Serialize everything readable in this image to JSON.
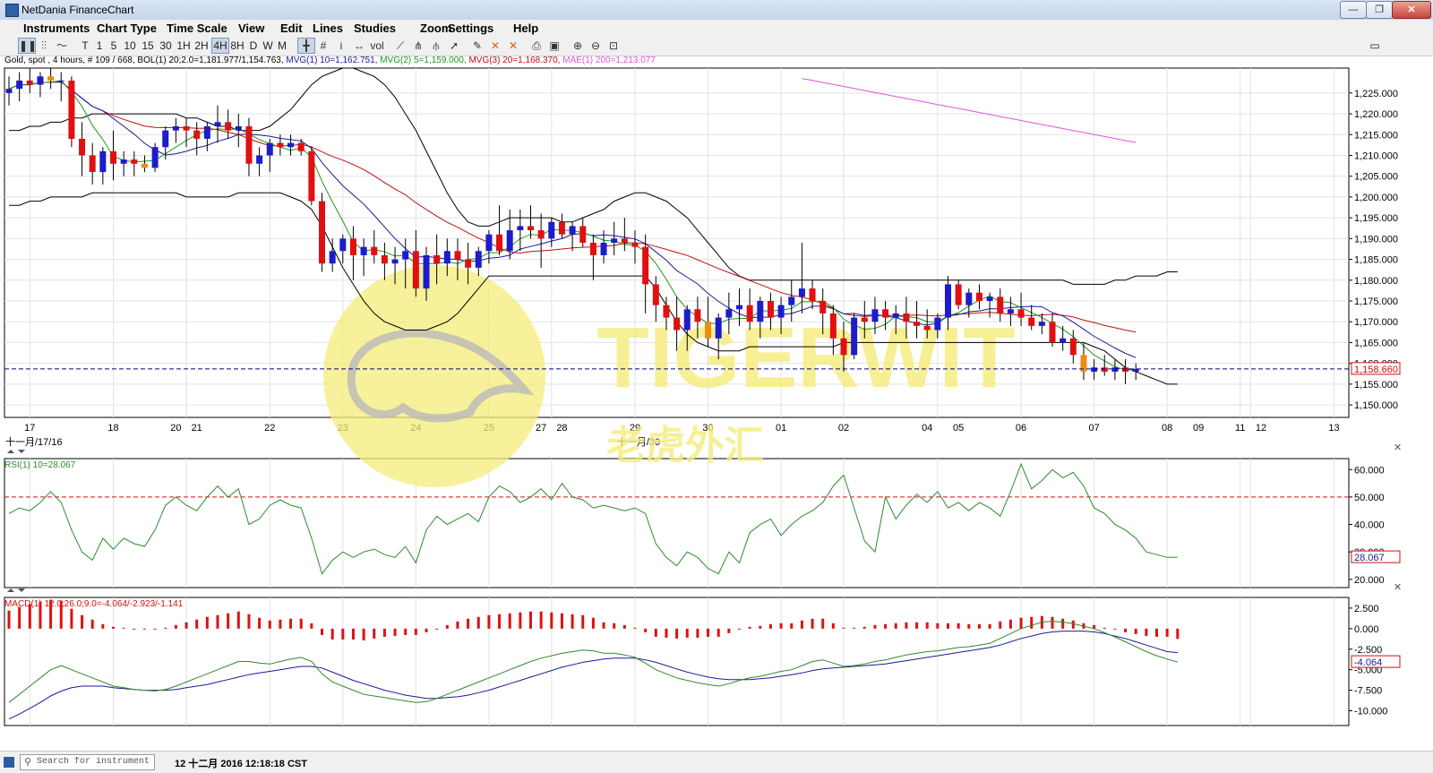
{
  "window": {
    "title": "NetDania FinanceChart",
    "minimize": "—",
    "maximize": "❐",
    "close": "✕"
  },
  "menu": [
    "Instruments",
    "Chart Type",
    "Time Scale",
    "View",
    "Edit",
    "Lines",
    "Studies",
    "Zoom",
    "Settings",
    "Help"
  ],
  "toolbar": {
    "chart_type_icons": [
      "candlestick-chart-icon",
      "bar-chart-icon",
      "line-chart-icon"
    ],
    "timescales": [
      "T",
      "1",
      "5",
      "10",
      "15",
      "30",
      "1H",
      "2H",
      "4H",
      "8H",
      "D",
      "W",
      "M"
    ],
    "selected_timescale": "4H",
    "tool_icons": [
      "crosshair-icon",
      "grid-icon",
      "info-icon",
      "arrows-icon",
      "volume-icon",
      "trend-line-icon",
      "fork-icon",
      "fan-icon",
      "arrow-tool-icon",
      "pen-icon",
      "delete-lines-icon",
      "delete-all-icon",
      "print-icon",
      "preview-icon",
      "zoom-in-icon",
      "zoom-out-icon",
      "zoom-fit-icon"
    ],
    "volume_label": "vol",
    "info_label": "i"
  },
  "legend": {
    "instrument": "Gold, spot , 4 hours, # 109 / 668, BOL(1) 20;2.0=1,181.977/1,154.763,",
    "mvg1": "MVG(1) 10=1,162.751,",
    "mvg2": "MVG(2) 5=1,159.000,",
    "mvg3": "MVG(3) 20=1,168.370,",
    "mae": "MAE(1) 200=1,213.077"
  },
  "colors": {
    "up_candle": "#1c1ccc",
    "down_candle": "#e01010",
    "orange_candle": "#f08a10",
    "mvg1": "#1a1a9a",
    "mvg2": "#1e9a1e",
    "mvg3": "#c01010",
    "mae": "#dd55dd",
    "bollinger": "#000000",
    "price_line": "#000080",
    "rsi": "#2d8a2d",
    "macd_signal": "#1a1a9a",
    "macd_line": "#2d8a2d",
    "macd_hist": "#e01010",
    "watermark": "#f6ec7a"
  },
  "watermark": {
    "brand": "TIGERWIT",
    "chinese": "老虎外汇"
  },
  "price_axis": {
    "ticks": [
      "1,225.000",
      "1,220.000",
      "1,215.000",
      "1,210.000",
      "1,205.000",
      "1,200.000",
      "1,195.000",
      "1,190.000",
      "1,185.000",
      "1,180.000",
      "1,175.000",
      "1,170.000",
      "1,165.000",
      "1,160.000",
      "1,155.000",
      "1,150.000"
    ],
    "last_price": "1,158.660"
  },
  "time_axis": {
    "labels": [
      "17",
      "18",
      "20",
      "21",
      "22",
      "23",
      "24",
      "25",
      "27",
      "28",
      "29",
      "30",
      "01",
      "02",
      "04",
      "05",
      "06",
      "07",
      "08",
      "09",
      "11",
      "12",
      "13"
    ],
    "month_labels": [
      "十一月/17/16",
      "十一月/30"
    ]
  },
  "rsi": {
    "label": "RSI(1) 10=28.067",
    "ticks": [
      "60.000",
      "50.000",
      "40.000",
      "30.000",
      "20.000"
    ],
    "last": "28.067",
    "level": 50
  },
  "macd": {
    "label": "MACD(1) 12.0;26.0;9.0=-4.064/-2.923/-1.141",
    "ticks": [
      "2.500",
      "0.000",
      "-2.500",
      "-5.000",
      "-7.500",
      "-10.000"
    ],
    "last": "-4.064"
  },
  "status": {
    "search_placeholder": "Search for instrument",
    "time": "12 十二月 2016 12:18:18 CST"
  },
  "chart_data": {
    "type": "candlestick",
    "instrument": "Gold, spot",
    "timeframe": "4 hours",
    "price_range": [
      1147,
      1231
    ],
    "ohlc": [
      [
        1225,
        1229,
        1222,
        1226
      ],
      [
        1226,
        1230,
        1223,
        1228
      ],
      [
        1228,
        1231,
        1225,
        1227
      ],
      [
        1227,
        1230,
        1224,
        1229
      ],
      [
        1229,
        1231,
        1226,
        1228
      ],
      [
        1228,
        1230,
        1223,
        1228
      ],
      [
        1228,
        1229,
        1212,
        1214
      ],
      [
        1214,
        1218,
        1205,
        1210
      ],
      [
        1210,
        1213,
        1203,
        1206
      ],
      [
        1206,
        1212,
        1203,
        1211
      ],
      [
        1211,
        1216,
        1204,
        1208
      ],
      [
        1208,
        1211,
        1205,
        1209
      ],
      [
        1209,
        1211,
        1205,
        1208
      ],
      [
        1208,
        1210,
        1206,
        1207
      ],
      [
        1207,
        1213,
        1206,
        1212
      ],
      [
        1212,
        1217,
        1209,
        1216
      ],
      [
        1216,
        1219,
        1213,
        1217
      ],
      [
        1217,
        1219,
        1212,
        1216
      ],
      [
        1216,
        1218,
        1210,
        1214
      ],
      [
        1214,
        1218,
        1211,
        1217
      ],
      [
        1217,
        1222,
        1213,
        1218
      ],
      [
        1218,
        1221,
        1214,
        1216
      ],
      [
        1216,
        1220,
        1212,
        1217
      ],
      [
        1217,
        1219,
        1205,
        1208
      ],
      [
        1208,
        1212,
        1205,
        1210
      ],
      [
        1210,
        1214,
        1206,
        1213
      ],
      [
        1213,
        1215,
        1210,
        1212
      ],
      [
        1212,
        1215,
        1210,
        1213
      ],
      [
        1213,
        1214,
        1210,
        1211
      ],
      [
        1211,
        1212,
        1198,
        1199
      ],
      [
        1199,
        1201,
        1182,
        1184
      ],
      [
        1184,
        1190,
        1182,
        1187
      ],
      [
        1187,
        1191,
        1184,
        1190
      ],
      [
        1190,
        1193,
        1180,
        1186
      ],
      [
        1186,
        1190,
        1181,
        1188
      ],
      [
        1188,
        1192,
        1184,
        1186
      ],
      [
        1186,
        1189,
        1180,
        1184
      ],
      [
        1184,
        1188,
        1179,
        1185
      ],
      [
        1185,
        1190,
        1178,
        1187
      ],
      [
        1187,
        1192,
        1176,
        1178
      ],
      [
        1178,
        1188,
        1175,
        1186
      ],
      [
        1186,
        1191,
        1179,
        1184
      ],
      [
        1184,
        1190,
        1181,
        1187
      ],
      [
        1187,
        1190,
        1180,
        1185
      ],
      [
        1185,
        1189,
        1179,
        1183
      ],
      [
        1183,
        1188,
        1181,
        1187
      ],
      [
        1187,
        1192,
        1184,
        1191
      ],
      [
        1191,
        1198,
        1186,
        1187
      ],
      [
        1187,
        1197,
        1185,
        1192
      ],
      [
        1192,
        1197,
        1187,
        1193
      ],
      [
        1193,
        1198,
        1190,
        1192
      ],
      [
        1192,
        1196,
        1183,
        1190
      ],
      [
        1190,
        1195,
        1188,
        1194
      ],
      [
        1194,
        1196,
        1190,
        1191
      ],
      [
        1191,
        1194,
        1187,
        1193
      ],
      [
        1193,
        1195,
        1188,
        1189
      ],
      [
        1189,
        1191,
        1180,
        1186
      ],
      [
        1186,
        1192,
        1184,
        1189
      ],
      [
        1189,
        1194,
        1186,
        1190
      ],
      [
        1190,
        1195,
        1187,
        1189
      ],
      [
        1189,
        1192,
        1184,
        1188
      ],
      [
        1188,
        1191,
        1172,
        1179
      ],
      [
        1179,
        1181,
        1170,
        1174
      ],
      [
        1174,
        1176,
        1168,
        1171
      ],
      [
        1171,
        1176,
        1163,
        1168
      ],
      [
        1168,
        1174,
        1163,
        1173
      ],
      [
        1173,
        1176,
        1166,
        1170
      ],
      [
        1170,
        1176,
        1164,
        1166
      ],
      [
        1166,
        1172,
        1161,
        1171
      ],
      [
        1171,
        1177,
        1167,
        1173
      ],
      [
        1173,
        1178,
        1169,
        1174
      ],
      [
        1174,
        1178,
        1168,
        1170
      ],
      [
        1170,
        1176,
        1166,
        1175
      ],
      [
        1175,
        1177,
        1168,
        1171
      ],
      [
        1171,
        1176,
        1167,
        1174
      ],
      [
        1174,
        1180,
        1170,
        1176
      ],
      [
        1176,
        1189,
        1172,
        1178
      ],
      [
        1178,
        1180,
        1173,
        1175
      ],
      [
        1175,
        1178,
        1167,
        1172
      ],
      [
        1172,
        1174,
        1162,
        1166
      ],
      [
        1166,
        1170,
        1158,
        1162
      ],
      [
        1162,
        1172,
        1161,
        1171
      ],
      [
        1171,
        1175,
        1166,
        1170
      ],
      [
        1170,
        1176,
        1167,
        1173
      ],
      [
        1173,
        1175,
        1168,
        1171
      ],
      [
        1171,
        1174,
        1167,
        1172
      ],
      [
        1172,
        1176,
        1166,
        1170
      ],
      [
        1170,
        1175,
        1166,
        1169
      ],
      [
        1169,
        1173,
        1166,
        1168
      ],
      [
        1168,
        1172,
        1166,
        1171
      ],
      [
        1171,
        1181,
        1168,
        1179
      ],
      [
        1179,
        1180,
        1173,
        1174
      ],
      [
        1174,
        1178,
        1171,
        1177
      ],
      [
        1177,
        1179,
        1173,
        1175
      ],
      [
        1175,
        1177,
        1171,
        1176
      ],
      [
        1176,
        1178,
        1170,
        1172
      ],
      [
        1172,
        1176,
        1169,
        1173
      ],
      [
        1173,
        1177,
        1169,
        1171
      ],
      [
        1171,
        1174,
        1168,
        1169
      ],
      [
        1169,
        1172,
        1167,
        1170
      ],
      [
        1170,
        1172,
        1164,
        1165
      ],
      [
        1165,
        1169,
        1163,
        1166
      ],
      [
        1166,
        1168,
        1160,
        1162
      ],
      [
        1162,
        1165,
        1156,
        1158
      ],
      [
        1158,
        1161,
        1156,
        1159
      ],
      [
        1159,
        1162,
        1157,
        1158
      ],
      [
        1158,
        1161,
        1156,
        1159
      ],
      [
        1159,
        1161,
        1155,
        1158
      ],
      [
        1158,
        1160,
        1156,
        1158.66
      ]
    ],
    "rsi_values": [
      44,
      46,
      45,
      48,
      52,
      48,
      38,
      30,
      27,
      35,
      31,
      35,
      33,
      32,
      38,
      47,
      50,
      47,
      45,
      50,
      54,
      50,
      53,
      40,
      42,
      47,
      49,
      47,
      46,
      35,
      22,
      27,
      30,
      28,
      30,
      31,
      29,
      28,
      32,
      26,
      38,
      43,
      40,
      42,
      44,
      41,
      50,
      54,
      52,
      48,
      50,
      53,
      49,
      55,
      50,
      49,
      46,
      47,
      46,
      45,
      46,
      44,
      33,
      28,
      25,
      30,
      28,
      24,
      22,
      30,
      26,
      37,
      40,
      42,
      36,
      40,
      43,
      45,
      48,
      54,
      58,
      46,
      34,
      30,
      50,
      42,
      47,
      51,
      48,
      52,
      46,
      48,
      45,
      48,
      46,
      43,
      52,
      62,
      53,
      56,
      60,
      57,
      59,
      54,
      46,
      44,
      40,
      38,
      35,
      30,
      29,
      28,
      28.067
    ],
    "macd_line": [
      -9,
      -8,
      -7,
      -6,
      -5,
      -4.5,
      -5,
      -5.5,
      -6,
      -6.5,
      -7,
      -7.2,
      -7.4,
      -7.5,
      -7.6,
      -7.4,
      -7,
      -6.5,
      -6,
      -5.5,
      -5,
      -4.5,
      -4,
      -4,
      -4.2,
      -4.3,
      -4,
      -3.7,
      -3.5,
      -4,
      -5.5,
      -6.5,
      -7,
      -7.5,
      -8,
      -8.2,
      -8.4,
      -8.6,
      -8.8,
      -9,
      -8.9,
      -8.5,
      -8,
      -7.5,
      -7,
      -6.5,
      -6,
      -5.5,
      -5,
      -4.5,
      -4,
      -3.6,
      -3.3,
      -3,
      -2.8,
      -2.6,
      -2.7,
      -3,
      -3,
      -3.2,
      -3.5,
      -4.2,
      -5,
      -5.5,
      -6,
      -6.3,
      -6.6,
      -6.8,
      -7,
      -6.7,
      -6.3,
      -6,
      -5.8,
      -5.5,
      -5.2,
      -5,
      -4.5,
      -4,
      -3.8,
      -4.2,
      -4.6,
      -4.5,
      -4.3,
      -4,
      -3.8,
      -3.5,
      -3.2,
      -3,
      -2.8,
      -2.7,
      -2.5,
      -2.3,
      -2.2,
      -2,
      -1.8,
      -1.2,
      -0.6,
      0,
      0.4,
      0.8,
      0.9,
      0.8,
      0.6,
      0.3,
      0,
      -0.5,
      -1,
      -1.6,
      -2.2,
      -2.8,
      -3.3,
      -3.7,
      -4.064
    ],
    "macd_signal": [
      -11,
      -10.4,
      -9.7,
      -9,
      -8.2,
      -7.6,
      -7.2,
      -7,
      -7,
      -7,
      -7.2,
      -7.3,
      -7.4,
      -7.5,
      -7.5,
      -7.5,
      -7.4,
      -7.2,
      -7,
      -6.8,
      -6.5,
      -6.2,
      -5.9,
      -5.6,
      -5.4,
      -5.2,
      -5,
      -4.8,
      -4.6,
      -4.6,
      -4.8,
      -5.3,
      -5.8,
      -6.3,
      -6.7,
      -7.1,
      -7.5,
      -7.8,
      -8.1,
      -8.3,
      -8.5,
      -8.5,
      -8.4,
      -8.3,
      -8.1,
      -7.8,
      -7.5,
      -7.1,
      -6.7,
      -6.3,
      -5.9,
      -5.5,
      -5.1,
      -4.7,
      -4.4,
      -4.1,
      -3.9,
      -3.7,
      -3.6,
      -3.6,
      -3.6,
      -3.8,
      -4.1,
      -4.5,
      -4.9,
      -5.3,
      -5.6,
      -5.9,
      -6.1,
      -6.2,
      -6.2,
      -6.2,
      -6.1,
      -6,
      -5.8,
      -5.6,
      -5.4,
      -5.1,
      -4.9,
      -4.8,
      -4.7,
      -4.6,
      -4.5,
      -4.4,
      -4.3,
      -4.1,
      -3.9,
      -3.7,
      -3.5,
      -3.3,
      -3.1,
      -2.9,
      -2.7,
      -2.5,
      -2.3,
      -2,
      -1.6,
      -1.2,
      -0.9,
      -0.6,
      -0.4,
      -0.3,
      -0.3,
      -0.3,
      -0.4,
      -0.6,
      -0.9,
      -1.2,
      -1.6,
      -2,
      -2.4,
      -2.8,
      -2.923
    ],
    "bollinger_upper": [
      1216,
      1216,
      1217,
      1217,
      1218,
      1218,
      1219,
      1219,
      1220,
      1220,
      1220,
      1220,
      1220,
      1220,
      1220,
      1220,
      1220,
      1219,
      1219,
      1218,
      1217,
      1217,
      1216,
      1216,
      1216,
      1217,
      1219,
      1221,
      1224,
      1227,
      1229,
      1230,
      1231,
      1231,
      1230,
      1229,
      1227,
      1224,
      1220,
      1216,
      1211,
      1206,
      1201,
      1197,
      1194,
      1193,
      1193,
      1194,
      1195,
      1195,
      1195,
      1195,
      1195,
      1194,
      1194,
      1195,
      1196,
      1197,
      1199,
      1200,
      1201,
      1201,
      1200,
      1199,
      1197,
      1195,
      1192,
      1189,
      1186,
      1183,
      1181,
      1180,
      1180,
      1180,
      1180,
      1180,
      1180,
      1180,
      1180,
      1180,
      1180,
      1180,
      1180,
      1180,
      1180,
      1180,
      1180,
      1180,
      1180,
      1180,
      1180,
      1180,
      1180,
      1180,
      1180,
      1180,
      1180,
      1180,
      1180,
      1180,
      1180,
      1180,
      1179,
      1179,
      1179,
      1179,
      1180,
      1180,
      1181,
      1181,
      1181,
      1182,
      1182
    ],
    "bollinger_lower": [
      1198,
      1198,
      1199,
      1199,
      1200,
      1200,
      1200,
      1200,
      1201,
      1201,
      1201,
      1201,
      1201,
      1201,
      1201,
      1201,
      1201,
      1200,
      1200,
      1200,
      1200,
      1200,
      1201,
      1201,
      1201,
      1201,
      1201,
      1200,
      1199,
      1197,
      1193,
      1188,
      1183,
      1179,
      1175,
      1172,
      1170,
      1169,
      1168,
      1168,
      1168,
      1169,
      1170,
      1172,
      1175,
      1178,
      1181,
      1181,
      1181,
      1181,
      1181,
      1181,
      1181,
      1181,
      1181,
      1181,
      1181,
      1181,
      1181,
      1181,
      1181,
      1181,
      1178,
      1174,
      1170,
      1167,
      1165,
      1164,
      1163,
      1163,
      1163,
      1164,
      1164,
      1164,
      1164,
      1164,
      1164,
      1164,
      1164,
      1164,
      1165,
      1165,
      1165,
      1165,
      1165,
      1165,
      1165,
      1165,
      1165,
      1165,
      1165,
      1165,
      1165,
      1165,
      1165,
      1165,
      1165,
      1165,
      1165,
      1165,
      1165,
      1165,
      1165,
      1165,
      1164,
      1163,
      1161,
      1159,
      1158,
      1157,
      1156,
      1155,
      1155
    ]
  }
}
